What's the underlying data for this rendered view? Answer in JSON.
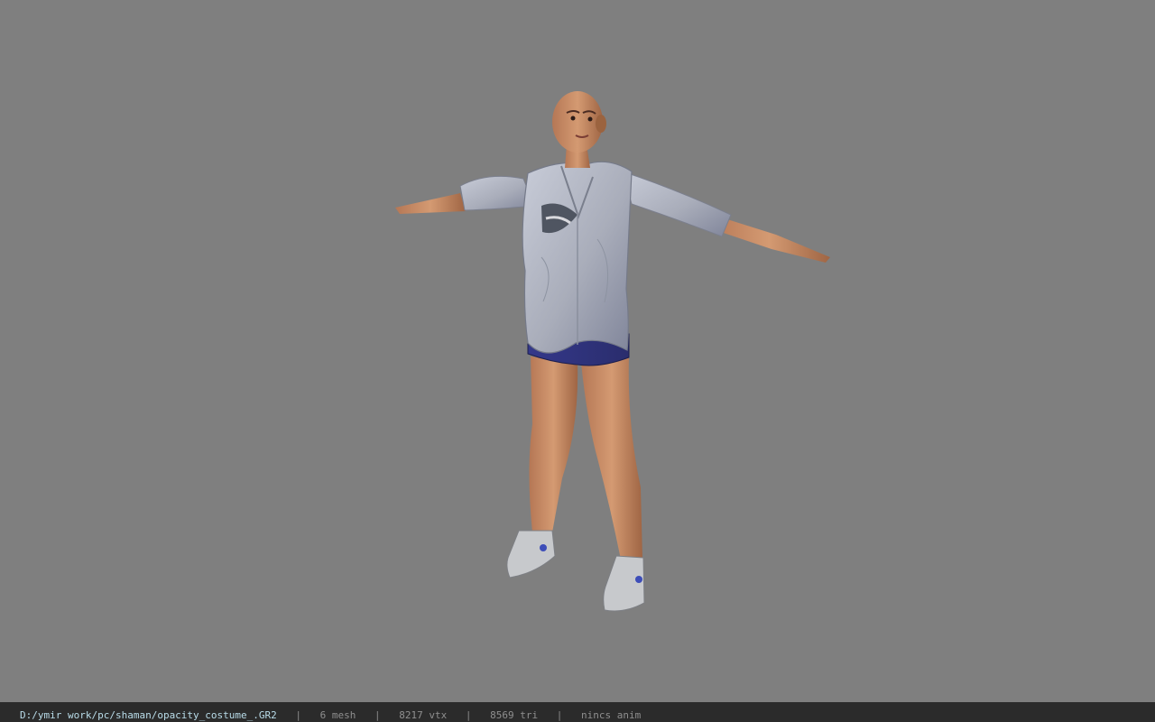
{
  "viewport": {
    "background": "#7f7f7f",
    "model_description_icon": "character-model-icon"
  },
  "status_bar": {
    "file_path": "D:/ymir work/pc/shaman/opacity_costume_.GR2",
    "separator": "|",
    "mesh_count": "6 mesh",
    "vertex_count": "8217 vtx",
    "triangle_count": "8569 tri",
    "animation": "nincs anim",
    "path_color": "#b9dce9",
    "background_color": "#2b2b2b"
  }
}
